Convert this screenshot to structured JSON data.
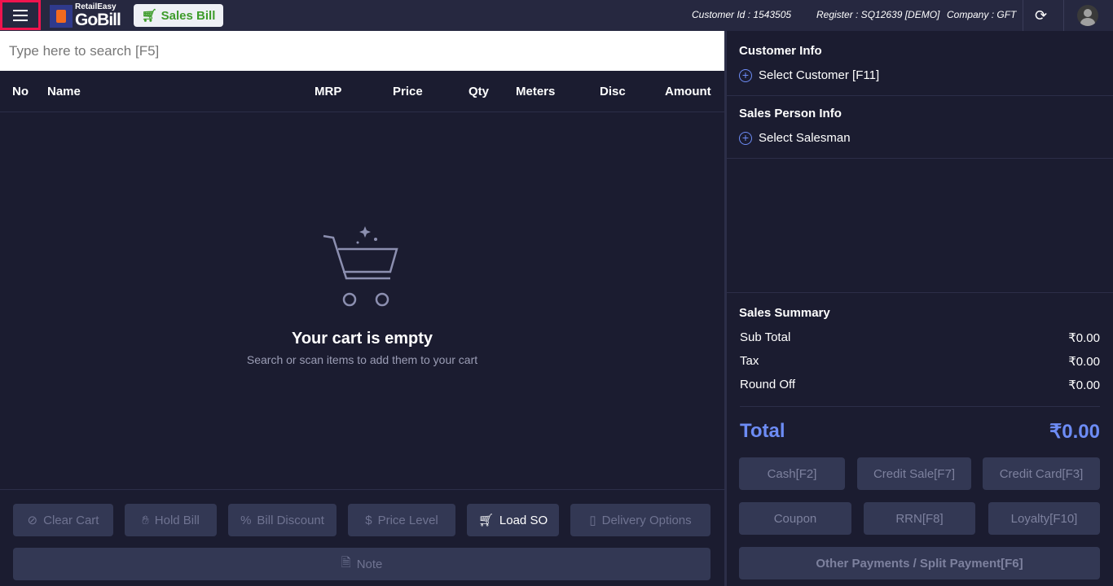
{
  "header": {
    "logo_small": "RetailEasy",
    "logo_big": "GoBill",
    "sales_bill": "Sales Bill",
    "customer_id": "Customer Id : 1543505",
    "register": "Register : SQ12639 [DEMO]",
    "company": "Company : GFT"
  },
  "search": {
    "placeholder": "Type here to search [F5]"
  },
  "table": {
    "columns": [
      "No",
      "Name",
      "MRP",
      "Price",
      "Qty",
      "Meters",
      "Disc",
      "Amount"
    ]
  },
  "empty": {
    "title": "Your cart is empty",
    "subtitle": "Search or scan items to add them to your cart"
  },
  "actions": {
    "clear_cart": "Clear Cart",
    "hold_bill": "Hold Bill",
    "bill_discount": "Bill Discount",
    "price_level": "Price Level",
    "load_so": "Load SO",
    "delivery_options": "Delivery Options",
    "note": "Note"
  },
  "customer": {
    "title": "Customer Info",
    "select": "Select Customer [F11]"
  },
  "salesperson": {
    "title": "Sales Person Info",
    "select": "Select Salesman"
  },
  "summary": {
    "title": "Sales Summary",
    "sub_total_label": "Sub Total",
    "sub_total": "₹0.00",
    "tax_label": "Tax",
    "tax": "₹0.00",
    "round_off_label": "Round Off",
    "round_off": "₹0.00",
    "total_label": "Total",
    "total": "₹0.00"
  },
  "payments": {
    "cash": "Cash[F2]",
    "credit_sale": "Credit Sale[F7]",
    "credit_card": "Credit Card[F3]",
    "coupon": "Coupon",
    "rrn": "RRN[F8]",
    "loyalty": "Loyalty[F10]",
    "other": "Other Payments / Split Payment[F6]"
  },
  "colors": {
    "accent": "#6d8cf5",
    "brand_green": "#3d9c2a",
    "highlight": "#f0144e"
  }
}
